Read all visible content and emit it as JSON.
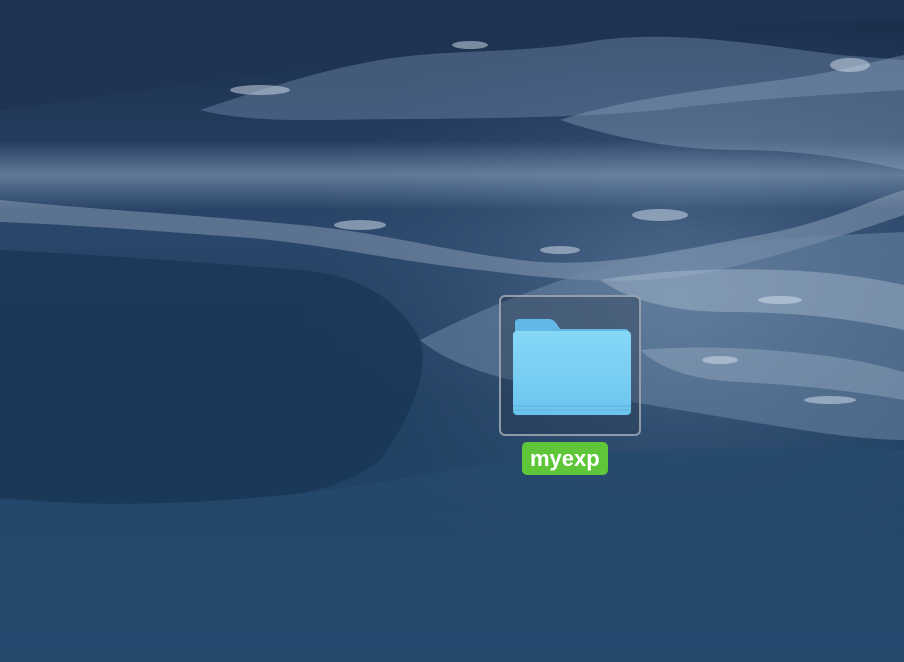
{
  "desktop": {
    "items": [
      {
        "label": "myexp",
        "icon": "folder-icon",
        "selected": true,
        "label_highlight_color": "#5fc63a",
        "icon_color": "#7dd3f5"
      }
    ]
  },
  "wallpaper": {
    "description_colors": {
      "deep_water": "#1c3a5c",
      "foam": "#b8c8da",
      "sky": "#1a2d4a"
    }
  }
}
